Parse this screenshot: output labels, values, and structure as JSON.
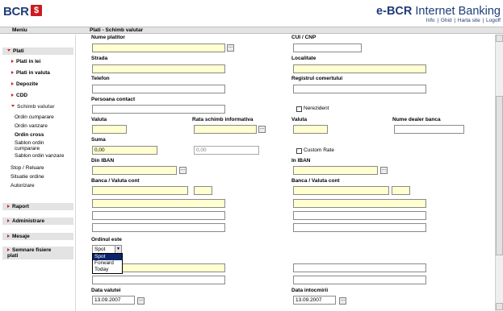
{
  "header": {
    "logo_text": "BCR",
    "logo_mark": "$",
    "brand_prefix": "e-BCR",
    "brand_suffix": "Internet Banking",
    "links": [
      "Info",
      "Ghid",
      "Harta site",
      "Logoff"
    ]
  },
  "topbar": {
    "menu_label": "Meniu",
    "breadcrumb": "Plati - Schimb valutar"
  },
  "sidebar": {
    "plati": "Plati",
    "plati_lei": "Plati in lei",
    "plati_valuta": "Plati in valuta",
    "depozite": "Depozite",
    "cdd": "CDD",
    "schimb": "Schimb valutar",
    "ordin_cumparare": "Ordin cumparare",
    "ordin_vanzare": "Ordin vanzare",
    "ordin_cross": "Ordin cross",
    "sablon_cumparare_1": "Sablon ordin",
    "sablon_cumparare_2": "cumparare",
    "sablon_vanzare": "Sablon ordin vanzare",
    "stop": "Stop / Reluare",
    "situatie": "Situatie ordine",
    "autorizare": "Autorizare",
    "raport": "Raport",
    "administrare": "Administrare",
    "mesaje": "Mesaje",
    "semnare_1": "Semnare fisiere",
    "semnare_2": "plati"
  },
  "form": {
    "nume_platitor": "Nume platitor",
    "cui_cnp": "CUI / CNP",
    "strada": "Strada",
    "localitate": "Localitate",
    "telefon": "Telefon",
    "registrul": "Registrul comertului",
    "persoana_contact": "Persoana contact",
    "nerezident": "Nerezident",
    "valuta_left": "Valuta",
    "rata_schimb": "Rata schimb informativa",
    "valuta_right": "Valuta",
    "nume_dealer": "Nume dealer banca",
    "suma": "Suma",
    "suma_value": "0,00",
    "rata_value": "0,00",
    "custom_rate": "Custom Rate",
    "din_iban": "Din IBAN",
    "in_iban": "In IBAN",
    "banca_left": "Banca / Valuta cont",
    "banca_right": "Banca / Valuta cont",
    "ordinul_este": "Ordinul este",
    "ordin_selected": "Spot",
    "ordin_options": [
      "Spot",
      "Forward",
      "Today"
    ],
    "data_valutei": "Data valutei",
    "data_valutei_value": "13.09.2007",
    "data_intocmirii": "Data intocmirii",
    "data_intocmirii_value": "13.09.2007",
    "lookup_btn": "..."
  },
  "colors": {
    "brand_blue": "#1f3c78",
    "accent_red": "#c62128",
    "field_yellow": "#ffffd0",
    "selection_blue": "#0a246a"
  }
}
